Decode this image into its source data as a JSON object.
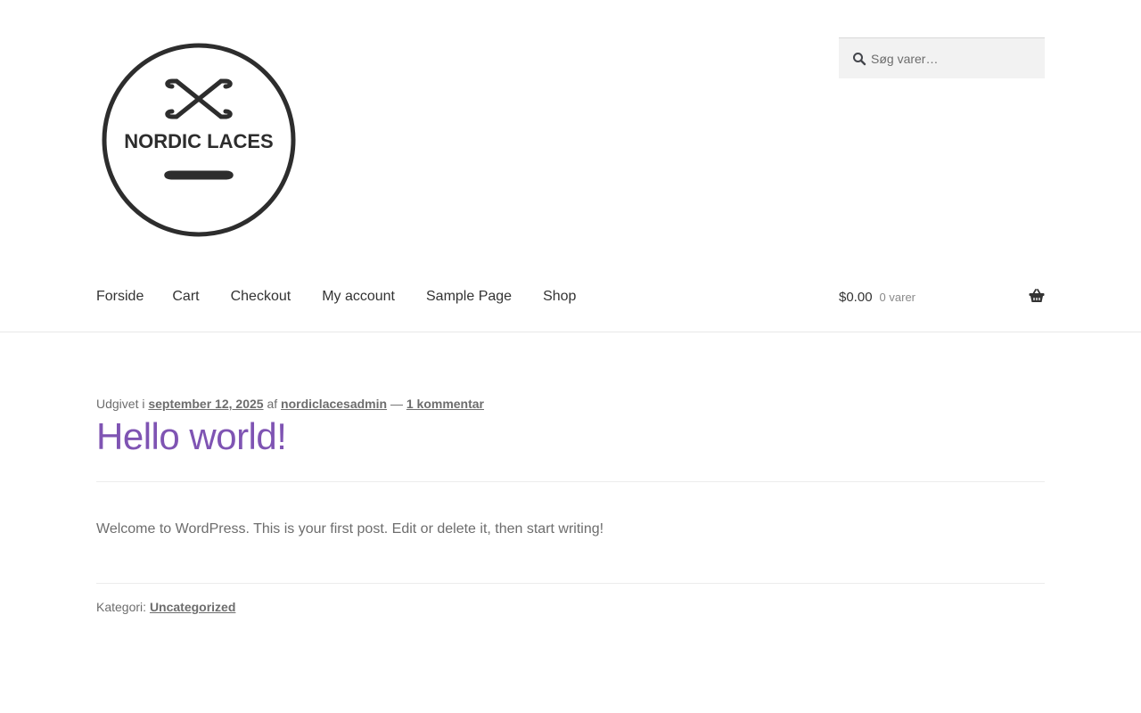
{
  "header": {
    "logo_text": "NORDIC LACES",
    "search": {
      "placeholder": "Søg varer…",
      "value": ""
    },
    "nav": {
      "items": [
        {
          "label": "Forside"
        },
        {
          "label": "Cart"
        },
        {
          "label": "Checkout"
        },
        {
          "label": "My account"
        },
        {
          "label": "Sample Page"
        },
        {
          "label": "Shop"
        }
      ]
    },
    "cart": {
      "amount": "$0.00",
      "count": "0 varer"
    }
  },
  "post": {
    "meta": {
      "prefix": "Udgivet i",
      "date": "september 12, 2025",
      "by": "af",
      "author": "nordiclacesadmin",
      "separator": "—",
      "comments": "1 kommentar"
    },
    "title": "Hello world!",
    "content": "Welcome to WordPress. This is your first post. Edit or delete it, then start writing!",
    "category_label": "Kategori:",
    "category": "Uncategorized"
  },
  "colors": {
    "accent": "#7f54b3",
    "text": "#6d6d6d",
    "heading": "#333333",
    "search_bg": "#f2f2f2"
  }
}
